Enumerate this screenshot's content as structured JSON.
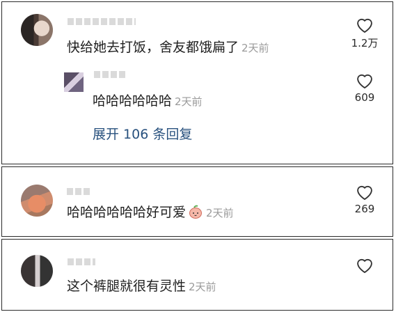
{
  "comments": [
    {
      "text": "快给她去打饭，舍友都饿扁了",
      "time": "2天前",
      "likes": "1.2万",
      "reply": {
        "text": "哈哈哈哈哈哈",
        "time": "2天前",
        "likes": "609"
      },
      "expand_label": "展开 106 条回复"
    },
    {
      "text": "哈哈哈哈哈哈好可爱",
      "time": "2天前",
      "likes": "269",
      "emoji": "peach-emoji"
    },
    {
      "text": "这个裤腿就很有灵性",
      "time": "2天前",
      "likes": ""
    }
  ],
  "colors": {
    "link": "#28517e",
    "time": "#9a9a9a",
    "text": "#1f1f1f"
  },
  "icons": {
    "like": "heart-outline-icon"
  }
}
